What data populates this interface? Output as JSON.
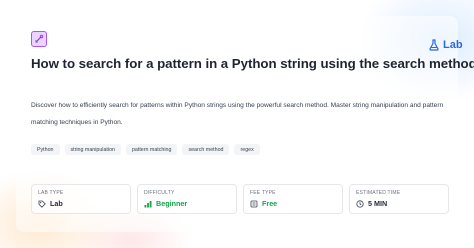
{
  "brand": {
    "label": "Lab"
  },
  "course": {
    "title": "How to search for a pattern in a Python string using the search method",
    "description": "Discover how to efficiently search for patterns within Python strings using the powerful search method. Master string manipulation and pattern matching techniques in Python."
  },
  "tags": [
    "Python",
    "string manipulation",
    "pattern matching",
    "search method",
    "regex"
  ],
  "stats": [
    {
      "label": "LAB TYPE",
      "value": "Lab",
      "icon": "tag-icon"
    },
    {
      "label": "DIFFICULTY",
      "value": "Beginner",
      "icon": "signal-bars-icon",
      "color": "#16a34a"
    },
    {
      "label": "FEE TYPE",
      "value": "Free",
      "icon": "stack-icon",
      "color": "#16a34a"
    },
    {
      "label": "ESTIMATED TIME",
      "value": "5 MIN",
      "icon": "clock-icon"
    }
  ],
  "colors": {
    "brand": "#2b6bd8",
    "accent_purple": "#a855f7",
    "success": "#16a34a"
  }
}
